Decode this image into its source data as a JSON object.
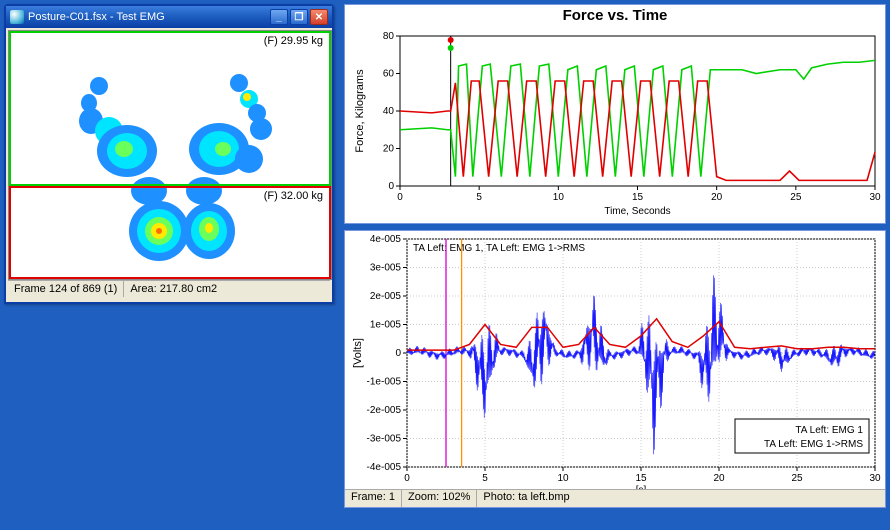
{
  "posture_window": {
    "title": "Posture-C01.fsx - Test  EMG",
    "top_region_label": "(F) 29.95 kg",
    "bottom_region_label": "(F) 32.00 kg",
    "status_frame": "Frame 124 of 869 (1)",
    "status_area": "Area:  217.80 cm2"
  },
  "force_chart": {
    "title": "Force vs. Time",
    "xlabel": "Time, Seconds",
    "ylabel": "Force, Kilograms"
  },
  "emg_chart": {
    "inner_title": "TA Left: EMG 1, TA Left: EMG 1->RMS",
    "xlabel": "[s]",
    "ylabel": "[Volts]",
    "legend1": "TA Left: EMG 1",
    "legend2": "TA Left: EMG 1->RMS",
    "status_frame": "Frame:  1",
    "status_zoom": "Zoom:  102%",
    "status_photo": "Photo:  ta left.bmp"
  },
  "chart_data": [
    {
      "type": "line",
      "title": "Force vs. Time",
      "xlabel": "Time, Seconds",
      "ylabel": "Force, Kilograms",
      "xlim": [
        0,
        30
      ],
      "ylim": [
        0,
        80
      ],
      "xticks": [
        0,
        5,
        10,
        15,
        20,
        25,
        30
      ],
      "yticks": [
        0,
        20,
        40,
        60,
        80
      ],
      "marker_x": 3.2,
      "series": [
        {
          "name": "Green",
          "color": "#00d000",
          "x": [
            0,
            2,
            3,
            3.2,
            3.5,
            3.7,
            4.2,
            4.6,
            5.2,
            5.7,
            6.4,
            7.0,
            7.6,
            8.2,
            8.8,
            9.4,
            10.0,
            10.6,
            11.2,
            11.8,
            12.4,
            13.0,
            13.6,
            14.2,
            14.8,
            15.4,
            16.0,
            16.6,
            17.2,
            17.8,
            18.4,
            19.0,
            19.6,
            20.2,
            21.0,
            21.6,
            22.5,
            24.0,
            25.0,
            25.5,
            26.0,
            27.0,
            28.0,
            29.0,
            30.0
          ],
          "y": [
            30,
            31,
            30,
            30,
            5,
            64,
            65,
            5,
            64,
            65,
            5,
            64,
            65,
            5,
            64,
            65,
            5,
            62,
            64,
            5,
            62,
            64,
            5,
            62,
            64,
            5,
            62,
            64,
            5,
            62,
            64,
            5,
            62,
            62,
            62,
            62,
            60,
            62,
            62,
            57,
            63,
            65,
            66,
            66,
            67
          ]
        },
        {
          "name": "Red",
          "color": "#e00000",
          "x": [
            0,
            2,
            3,
            3.2,
            3.5,
            4.0,
            4.5,
            5.0,
            5.6,
            6.2,
            6.8,
            7.4,
            8.0,
            8.6,
            9.2,
            9.8,
            10.4,
            11.0,
            11.6,
            12.2,
            12.8,
            13.4,
            14.0,
            14.6,
            15.2,
            15.8,
            16.4,
            17.0,
            17.6,
            18.2,
            18.8,
            19.4,
            20.0,
            20.6,
            21.2,
            22.0,
            23.0,
            24.0,
            24.6,
            25.2,
            25.8,
            26.5,
            27.5,
            28.5,
            29.5,
            30.0
          ],
          "y": [
            40,
            39,
            40,
            40,
            55,
            5,
            56,
            56,
            5,
            56,
            56,
            5,
            56,
            56,
            5,
            56,
            56,
            5,
            56,
            56,
            5,
            56,
            56,
            5,
            56,
            56,
            5,
            56,
            56,
            5,
            56,
            56,
            5,
            3,
            3,
            3,
            3,
            3,
            8,
            3,
            3,
            3,
            3,
            3,
            3,
            18
          ]
        }
      ]
    },
    {
      "type": "line",
      "title": "TA Left: EMG 1, TA Left: EMG 1->RMS",
      "xlabel": "[s]",
      "ylabel": "[Volts]",
      "xlim": [
        0,
        30
      ],
      "ylim": [
        -4e-05,
        4e-05
      ],
      "xticks": [
        0,
        5,
        10,
        15,
        20,
        25,
        30
      ],
      "yticks": [
        -4e-05,
        -3e-05,
        -2e-05,
        -1e-05,
        0,
        1e-05,
        2e-05,
        3e-05,
        4e-05
      ],
      "ytick_labels": [
        "-4e-005",
        "-3e-005",
        "-2e-005",
        "-1e-005",
        "0",
        "1e-005",
        "2e-005",
        "3e-005",
        "4e-005"
      ],
      "cursor_lines": [
        2.5,
        3.5
      ],
      "legend": [
        "TA Left: EMG 1",
        "TA Left: EMG 1->RMS"
      ],
      "legend_colors": [
        "#1a1aff",
        "#e00000"
      ],
      "series": [
        {
          "name": "TA Left: EMG 1",
          "color": "#1a1aff",
          "bursts_center_x": [
            5,
            8.5,
            12,
            15.8,
            19.6,
            24.0,
            27.5
          ],
          "bursts_peak": [
            2.8e-05,
            2.8e-05,
            2.4e-05,
            3.9e-05,
            3.6e-05,
            8e-06,
            8e-06
          ],
          "bursts_trough": [
            -2.2e-05,
            -2.2e-05,
            -2e-05,
            -2.8e-05,
            -2.4e-05,
            -6e-06,
            -6e-06
          ],
          "baseline_noise": 2.5e-06
        },
        {
          "name": "TA Left: EMG 1->RMS",
          "color": "#e00000",
          "x": [
            0,
            3,
            4,
            5,
            6,
            7,
            8,
            9,
            10,
            11,
            12,
            13,
            14,
            15,
            16,
            17,
            18,
            19,
            20,
            21,
            22,
            23,
            24,
            25,
            26,
            27,
            28,
            29,
            30
          ],
          "y": [
            1e-06,
            1e-06,
            3e-06,
            1e-05,
            3e-06,
            2e-06,
            9e-06,
            9e-06,
            2e-06,
            3e-06,
            9e-06,
            3e-06,
            2e-06,
            6e-06,
            1.2e-05,
            4e-06,
            2e-06,
            6e-06,
            1.1e-05,
            2e-06,
            1.5e-06,
            2e-06,
            2.5e-06,
            1.5e-06,
            1.5e-06,
            2e-06,
            2e-06,
            1.5e-06,
            1.5e-06
          ]
        }
      ]
    }
  ]
}
